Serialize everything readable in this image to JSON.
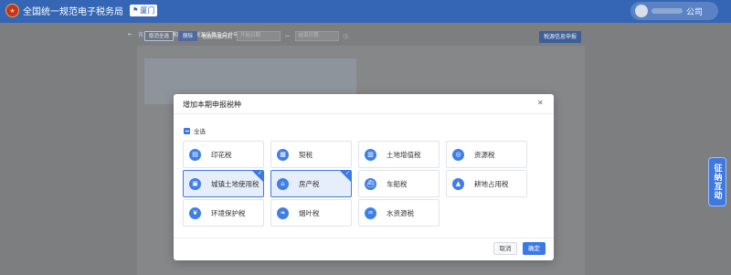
{
  "header": {
    "title": "全国统一规范电子税务局",
    "city": "厦门",
    "company_suffix": "公司"
  },
  "breadcrumb": {
    "home": "首页",
    "separator": "/",
    "current": "财产和行为税税源采集及合并申报"
  },
  "toolbar": {
    "cancel_select": "取消全选",
    "delete": "删除",
    "period_label": "税款所属时间",
    "start_placeholder": "开始日期",
    "range_sep": "—",
    "end_placeholder": "结束日期",
    "right_button": "税源信息申报"
  },
  "side_float": "征纳互动",
  "modal": {
    "title": "增加本期申报税种",
    "select_all": "全选",
    "items": [
      {
        "label": "印花税",
        "icon": "stamp-icon",
        "selected": false
      },
      {
        "label": "契税",
        "icon": "deed-icon",
        "selected": false
      },
      {
        "label": "土地增值税",
        "icon": "land-value-icon",
        "selected": false
      },
      {
        "label": "资源税",
        "icon": "resource-icon",
        "selected": false
      },
      {
        "label": "城镇土地使用税",
        "icon": "urban-land-icon",
        "selected": true
      },
      {
        "label": "房产税",
        "icon": "property-icon",
        "selected": true
      },
      {
        "label": "车船税",
        "icon": "vehicle-vessel-icon",
        "selected": false
      },
      {
        "label": "耕地占用税",
        "icon": "farmland-icon",
        "selected": false
      },
      {
        "label": "环境保护税",
        "icon": "environment-icon",
        "selected": false
      },
      {
        "label": "烟叶税",
        "icon": "tobacco-icon",
        "selected": false
      },
      {
        "label": "水资源税",
        "icon": "water-icon",
        "selected": false
      }
    ],
    "cancel": "取消",
    "confirm": "确定"
  },
  "colors": {
    "header": "#3466b5",
    "primary": "#3d79e6",
    "selected_bg": "#e7eefb"
  }
}
